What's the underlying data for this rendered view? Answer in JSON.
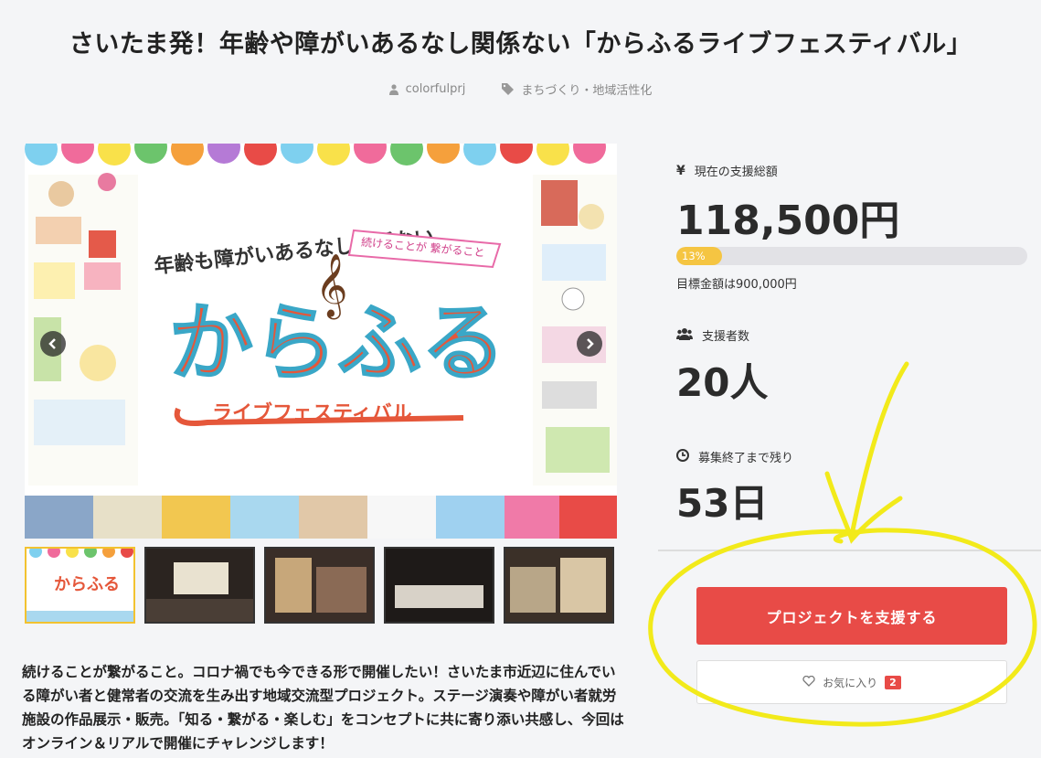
{
  "project": {
    "title": "さいたま発！年齢や障がいあるなし関係ない「からふるライブフェスティバル」",
    "author": "colorfulprj",
    "tag": "まちづくり・地域活性化",
    "description": "続けることが繋がること。コロナ禍でも今できる形で開催したい！さいたま市近辺に住んでいる障がい者と健常者の交流を生み出す地域交流型プロジェクト。ステージ演奏や障がい者就労施設の作品展示・販売。「知る・繋がる・楽しむ」をコンセプトに共に寄り添い共感し、今回はオンライン＆リアルで開催にチャレンジします！"
  },
  "hero": {
    "tagline": "年齢も障がいあるなし関係ない",
    "banner": "続けることが 繋がること",
    "logo_main": "からふる",
    "logo_sub": "ライブフェスティバル"
  },
  "stats": {
    "total_label": "現在の支援総額",
    "total_value": "118,500円",
    "progress_text": "13%",
    "progress_fraction": 0.13,
    "goal_text": "目標金額は900,000円",
    "backers_label": "支援者数",
    "backers_value": "20人",
    "remaining_label": "募集終了まで残り",
    "remaining_value": "53日"
  },
  "actions": {
    "support_label": "プロジェクトを支援する",
    "favorite_label": "お気に入り",
    "favorite_count": "2"
  },
  "colors": {
    "accent_red": "#e84b47",
    "progress_yellow": "#f5c542",
    "annotation_yellow": "#f2ea1a"
  }
}
